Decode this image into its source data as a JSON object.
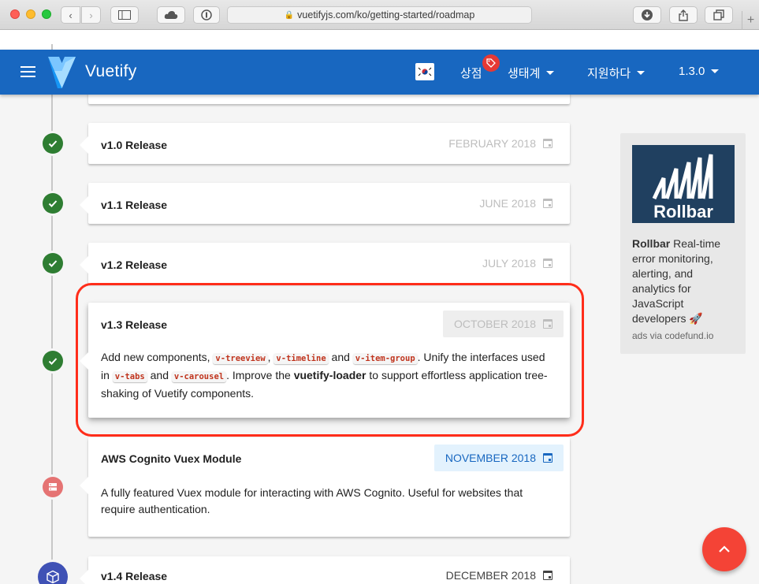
{
  "browser": {
    "url": "vuetifyjs.com/ko/getting-started/roadmap"
  },
  "appbar": {
    "brand": "Vuetify",
    "store_label": "상점",
    "ecosystem_label": "생태계",
    "support_label": "지원하다",
    "version_label": "1.3.0",
    "accent_color": "#1867c0"
  },
  "timeline": [
    {
      "title": "v1.0 Release",
      "date": "FEBRUARY 2018",
      "status": "done"
    },
    {
      "title": "v1.1 Release",
      "date": "JUNE 2018",
      "status": "done"
    },
    {
      "title": "v1.2 Release",
      "date": "JULY 2018",
      "status": "done"
    },
    {
      "title": "v1.3 Release",
      "date": "OCTOBER 2018",
      "status": "done",
      "body": {
        "t1": "Add new components, ",
        "c1": "v-treeview",
        "t2": ", ",
        "c2": "v-timeline",
        "t3": " and ",
        "c3": "v-item-group",
        "t4": ". Unify the interfaces used in ",
        "c4": "v-tabs",
        "t5": " and ",
        "c5": "v-carousel",
        "t6": ". Improve the ",
        "b1": "vuetify-loader",
        "t7": " to support effortless application tree-shaking of Vuetify components."
      }
    },
    {
      "title": "AWS Cognito Vuex Module",
      "date": "NOVEMBER 2018",
      "status": "in-progress",
      "body": "A fully featured Vuex module for interacting with AWS Cognito. Useful for websites that require authentication."
    },
    {
      "title": "v1.4 Release",
      "date": "DECEMBER 2018",
      "status": "planned"
    }
  ],
  "ad": {
    "logo_text": "Rollbar",
    "brand": "Rollbar",
    "text": " Real-time error monitoring, alerting, and analytics for JavaScript developers 🚀",
    "via": "ads via codefund.io"
  }
}
